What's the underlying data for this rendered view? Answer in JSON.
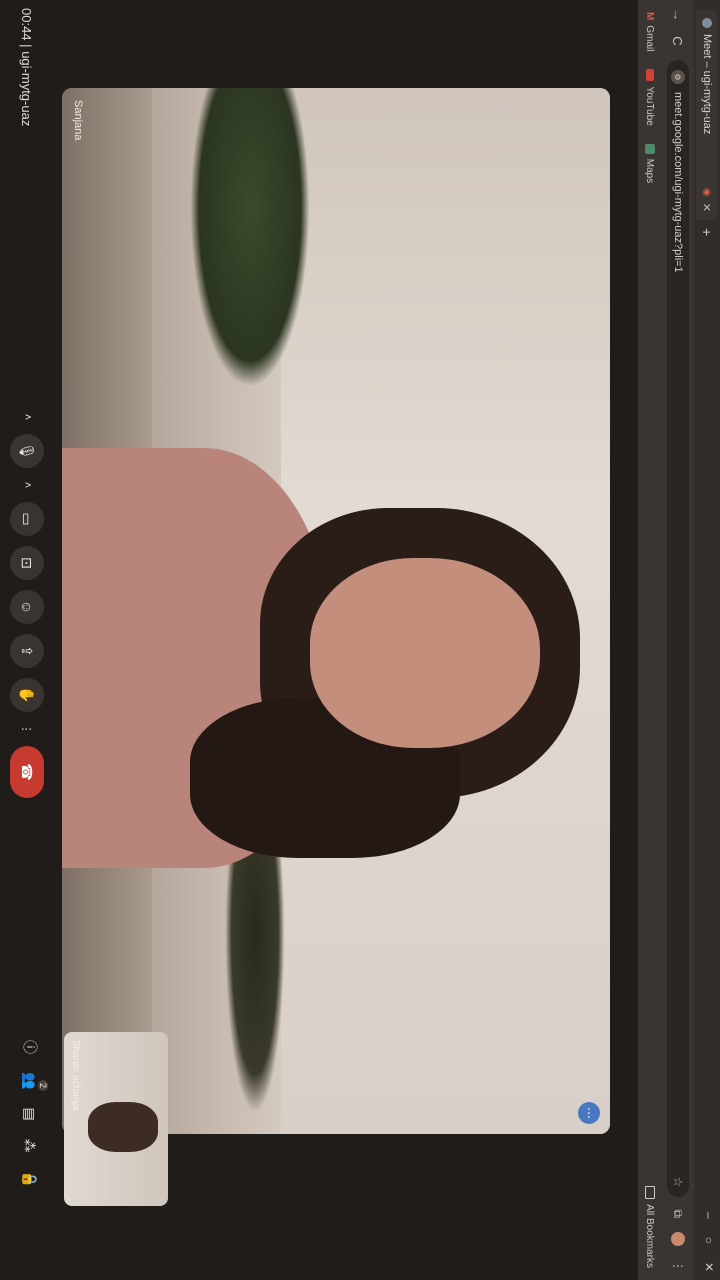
{
  "browser": {
    "tab_title": "Meet – ugi-mytg-uaz",
    "tab_rec_icon": "record-icon",
    "new_tab_label": "+",
    "url": "meet.google.com/ugi-mytg-uaz?pli=1",
    "bookmarks": [
      {
        "label": "Gmail",
        "icon": "gmail-icon"
      },
      {
        "label": "YouTube",
        "icon": "youtube-icon"
      },
      {
        "label": "Maps",
        "icon": "maps-icon"
      }
    ],
    "all_bookmarks_label": "All Bookmarks"
  },
  "meet": {
    "main_participant": "Sanjana",
    "self_participant": "Sharan acharya",
    "meeting_time": "00:44",
    "separator": "|",
    "meeting_code": "ugi-mytg-uaz",
    "participants_count": "2"
  },
  "colors": {
    "end_call": "#c63a30",
    "more_button": "#4a78c0"
  }
}
